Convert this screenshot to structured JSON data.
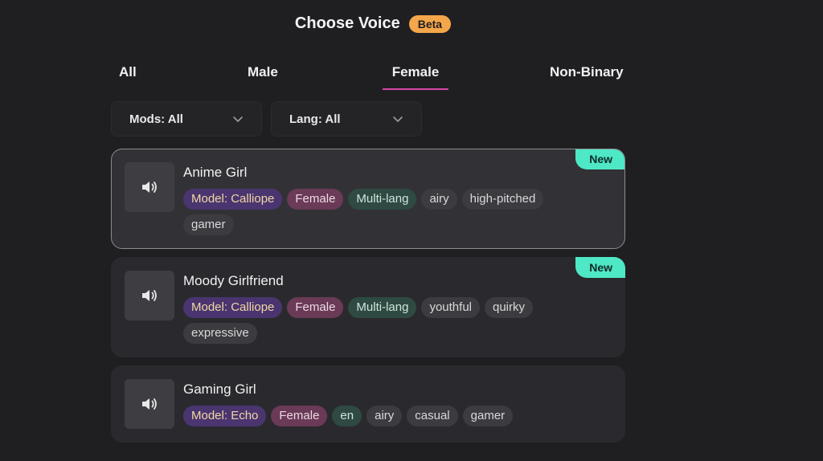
{
  "header": {
    "title": "Choose Voice",
    "badge": "Beta"
  },
  "tabs": [
    {
      "label": "All",
      "active": false
    },
    {
      "label": "Male",
      "active": false
    },
    {
      "label": "Female",
      "active": true
    },
    {
      "label": "Non-Binary",
      "active": false
    }
  ],
  "filters": {
    "mods_label": "Mods: All",
    "lang_label": "Lang: All"
  },
  "colors": {
    "accent_tab_underline": "#d946a8",
    "beta_badge": "#f4a64a",
    "new_badge": "#4ee8c6"
  },
  "voices": [
    {
      "name": "Anime Girl",
      "new_badge": "New",
      "selected": true,
      "tags": [
        "Model: Calliope",
        "Female",
        "Multi-lang",
        "airy",
        "high-pitched",
        "gamer"
      ]
    },
    {
      "name": "Moody Girlfriend",
      "new_badge": "New",
      "selected": false,
      "tags": [
        "Model: Calliope",
        "Female",
        "Multi-lang",
        "youthful",
        "quirky",
        "expressive"
      ]
    },
    {
      "name": "Gaming Girl",
      "new_badge": "",
      "selected": false,
      "tags": [
        "Model: Echo",
        "Female",
        "en",
        "airy",
        "casual",
        "gamer"
      ]
    }
  ],
  "icons": {
    "play": "speaker-icon",
    "dropdown": "chevron-down-icon"
  }
}
